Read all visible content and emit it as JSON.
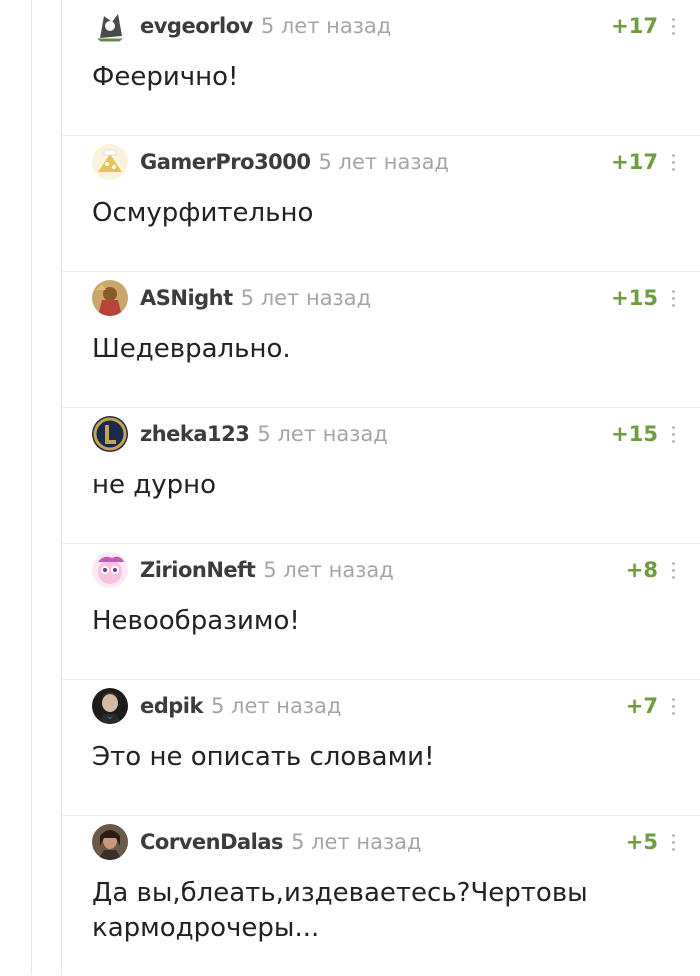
{
  "comments": [
    {
      "user": "evgeorlov",
      "time": "5 лет назад",
      "rating": "+17",
      "text": "Феерично!"
    },
    {
      "user": "GamerPro3000",
      "time": "5 лет назад",
      "rating": "+17",
      "text": "Осмурфительно"
    },
    {
      "user": "ASNight",
      "time": "5 лет назад",
      "rating": "+15",
      "text": "Шедеврально."
    },
    {
      "user": "zheka123",
      "time": "5 лет назад",
      "rating": "+15",
      "text": "не дурно"
    },
    {
      "user": "ZirionNeft",
      "time": "5 лет назад",
      "rating": "+8",
      "text": "Невообразимо!"
    },
    {
      "user": "edpik",
      "time": "5 лет назад",
      "rating": "+7",
      "text": "Это не описать словами!"
    },
    {
      "user": "CorvenDalas",
      "time": "5 лет назад",
      "rating": "+5",
      "text": "Да вы,блеать,издеваетесь?Чертовы кармодрочеры..."
    }
  ],
  "colors": {
    "rating": "#6e9c3e",
    "username": "#3c3c3c",
    "time": "#a5a5a5",
    "text": "#222222"
  }
}
